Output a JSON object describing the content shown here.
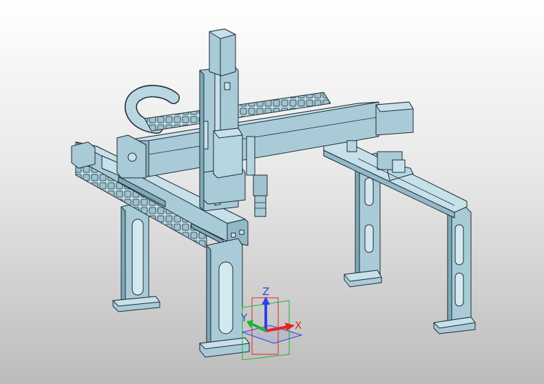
{
  "viewport": {
    "background_top": "#ffffff",
    "background_bottom": "#bcbcbc"
  },
  "model": {
    "body_color": "#a9cbd8",
    "light_color": "#c7e0ea",
    "dark_color": "#7ea9b9",
    "edge_color": "#1b2a30"
  },
  "triad": {
    "x_label": "X",
    "y_label": "Y",
    "z_label": "Z",
    "x_color": "#e8211d",
    "y_color": "#19b82b",
    "z_color": "#2a43e0"
  }
}
